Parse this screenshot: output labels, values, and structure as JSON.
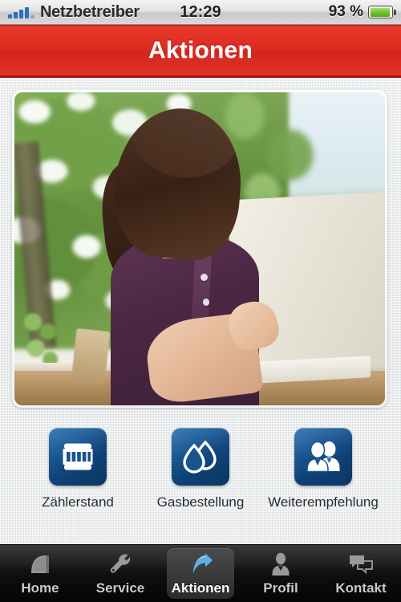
{
  "status_bar": {
    "signal_icon": "signal-bars-icon",
    "carrier": "Netzbetreiber",
    "time": "12:29",
    "battery_percent": "93 %",
    "battery_level": 93,
    "battery_icon": "battery-icon"
  },
  "header": {
    "title": "Aktionen",
    "background_color": "#dd2a20",
    "text_color": "#ffffff"
  },
  "hero": {
    "alt": "Frau mit Laptop im Freien vor blühenden Bäumen"
  },
  "tiles": [
    {
      "label": "Zählerstand",
      "icon": "meter-icon"
    },
    {
      "label": "Gasbestellung",
      "icon": "water-drops-icon"
    },
    {
      "label": "Weiterempfehlung",
      "icon": "two-people-icon"
    }
  ],
  "tile_style": {
    "accent_color": "#18548e",
    "icon_color": "#ffffff"
  },
  "tabbar": [
    {
      "label": "Home",
      "icon": "home-icon",
      "active": false
    },
    {
      "label": "Service",
      "icon": "wrench-icon",
      "active": false
    },
    {
      "label": "Aktionen",
      "icon": "arrow-icon",
      "active": true
    },
    {
      "label": "Profil",
      "icon": "person-icon",
      "active": false
    },
    {
      "label": "Kontakt",
      "icon": "chat-icon",
      "active": false
    }
  ],
  "tabbar_style": {
    "active_icon_color": "#4a9fe0",
    "inactive_icon_color": "#9a9a9a",
    "background_color": "#101010"
  }
}
